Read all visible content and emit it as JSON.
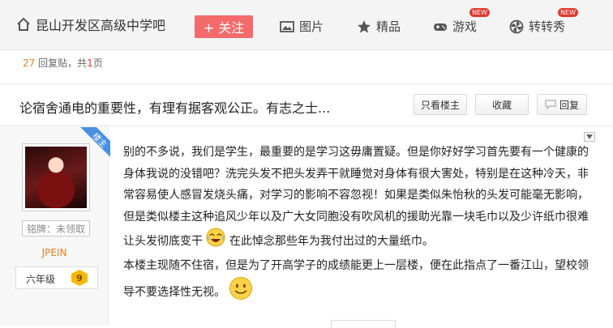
{
  "nav": {
    "forum_name": "昆山开发区高级中学吧",
    "follow_label": "+ 关注",
    "items": [
      {
        "label": "图片",
        "icon": "image-icon",
        "badge": ""
      },
      {
        "label": "精品",
        "icon": "star-icon",
        "badge": ""
      },
      {
        "label": "游戏",
        "icon": "gamepad-icon",
        "badge": "NEW"
      },
      {
        "label": "转转秀",
        "icon": "pinwheel-icon",
        "badge": "NEW"
      }
    ]
  },
  "reply_info": {
    "count": "27",
    "text_reply": "回复贴，共",
    "pages": "1",
    "text_page": "页"
  },
  "thread": {
    "title": "论宿舍通电的重要性，有理有据客观公正。有志之士...",
    "only_op_label": "只看楼主",
    "favorite_label": "收藏",
    "reply_label": "回复"
  },
  "author": {
    "ribbon": "楼主",
    "medal": "铭牌：未领取",
    "name": "JPEIN",
    "level_name": "六年级",
    "level_num": "9"
  },
  "post": {
    "p1": "别的不多说，我们是学生，最重要的是学习这毋庸置疑。但是你好好学习首先要有一个健康的身体我说的没错吧？洗完头发不把头发弄干就睡觉对身体有很大害处，特别是在这种冷天，非常容易使人感冒发烧头痛，对学习的影响不容忽视！如果是类似朱怡秋的头发可能毫无影响，但是类似楼主这种追风少年以及广大女同胞没有吹风机的援助光靠一块毛巾以及少许纸巾很难让头发彻底变干",
    "p1_tail": "在此悼念那些年为我付出过的大量纸巾。",
    "p2": "本楼主现随不住宿，但是为了开高学子的成绩能更上一层楼，便在此指点了一番江山，望校领导不要选择性无视。"
  }
}
